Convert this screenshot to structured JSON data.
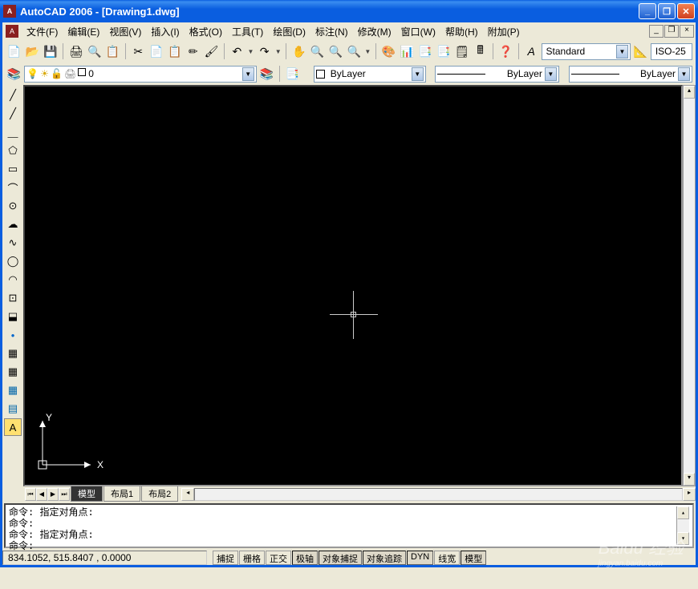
{
  "title": "AutoCAD 2006 - [Drawing1.dwg]",
  "menus": [
    "文件(F)",
    "编辑(E)",
    "视图(V)",
    "插入(I)",
    "格式(O)",
    "工具(T)",
    "绘图(D)",
    "标注(N)",
    "修改(M)",
    "窗口(W)",
    "帮助(H)",
    "附加(P)"
  ],
  "std_toolbar": {
    "icons": [
      "📄",
      "📂",
      "💾",
      "🖨",
      "🔍",
      "📋",
      "✂",
      "📄",
      "📋",
      "✏",
      "🖌",
      "↶",
      "↷",
      "🔎",
      "🔍",
      "🔍",
      "🔍",
      "🎨",
      "📊",
      "📑",
      "📑",
      "🖩",
      "📄",
      "❓"
    ]
  },
  "style_combo": "Standard",
  "dim_combo": "ISO-25",
  "layer": {
    "current": "0"
  },
  "color_combo": "ByLayer",
  "linetype_combo": "ByLayer",
  "lineweight_combo": "ByLayer",
  "draw_tools": [
    "╱",
    "╱",
    "⸏",
    "▱",
    "⬠",
    "⌒",
    "⌒",
    "⊙",
    "∿",
    "☁",
    "〰",
    "◯",
    "◯",
    "⊙",
    "⬓",
    "▦",
    "▦",
    "▦",
    "◼",
    "A"
  ],
  "tabs": {
    "active": "模型",
    "layouts": [
      "布局1",
      "布局2"
    ]
  },
  "command": {
    "hist1": "命令: 指定对角点:",
    "hist2": "命令:",
    "hist3": "命令: 指定对角点:",
    "prompt": "命令:"
  },
  "status": {
    "coords": "834.1052, 515.8407 , 0.0000",
    "toggles": [
      "捕捉",
      "栅格",
      "正交",
      "极轴",
      "对象捕捉",
      "对象追踪",
      "DYN",
      "线宽",
      "模型"
    ]
  },
  "watermark": {
    "main": "Baidu 经验",
    "sub": "jingyan.baidu.com"
  },
  "ucs": {
    "x": "X",
    "y": "Y"
  }
}
